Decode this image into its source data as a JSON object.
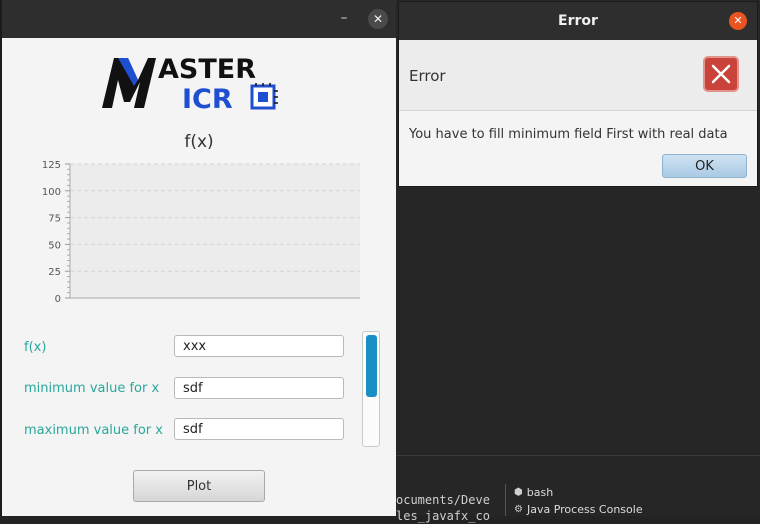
{
  "app": {
    "logo_top": "ASTER",
    "logo_bottom": "ICR",
    "chart_title": "f(x)",
    "fields": [
      {
        "label": "f(x)",
        "value": "xxx"
      },
      {
        "label": "minimum value for x",
        "value": "sdf"
      },
      {
        "label": "maximum value for x",
        "value": "sdf"
      }
    ],
    "plot_label": "Plot",
    "minimize_symbol": "–",
    "close_symbol": "✕"
  },
  "chart_data": {
    "type": "line",
    "title": "f(x)",
    "xlabel": "",
    "ylabel": "",
    "ylim": [
      0,
      125
    ],
    "yticks": [
      "0",
      "25",
      "50",
      "75",
      "100",
      "125"
    ],
    "series": [],
    "grid": true
  },
  "dialog": {
    "title": "Error",
    "header": "Error",
    "message": "You have to fill minimum field First with real data",
    "ok_label": "OK",
    "close_symbol": "✕"
  },
  "terminal": {
    "line1": "ocuments/Deve",
    "line2": "les_javafx_co",
    "tabs": [
      {
        "icon": "terminal-icon",
        "label": "bash"
      },
      {
        "icon": "gear-icon",
        "label": "Java Process Console"
      }
    ]
  },
  "colors": {
    "label_teal": "#2aa79b",
    "accent_orange": "#e95420",
    "error_red": "#c9433a",
    "scroll_blue": "#1a8fc6"
  }
}
